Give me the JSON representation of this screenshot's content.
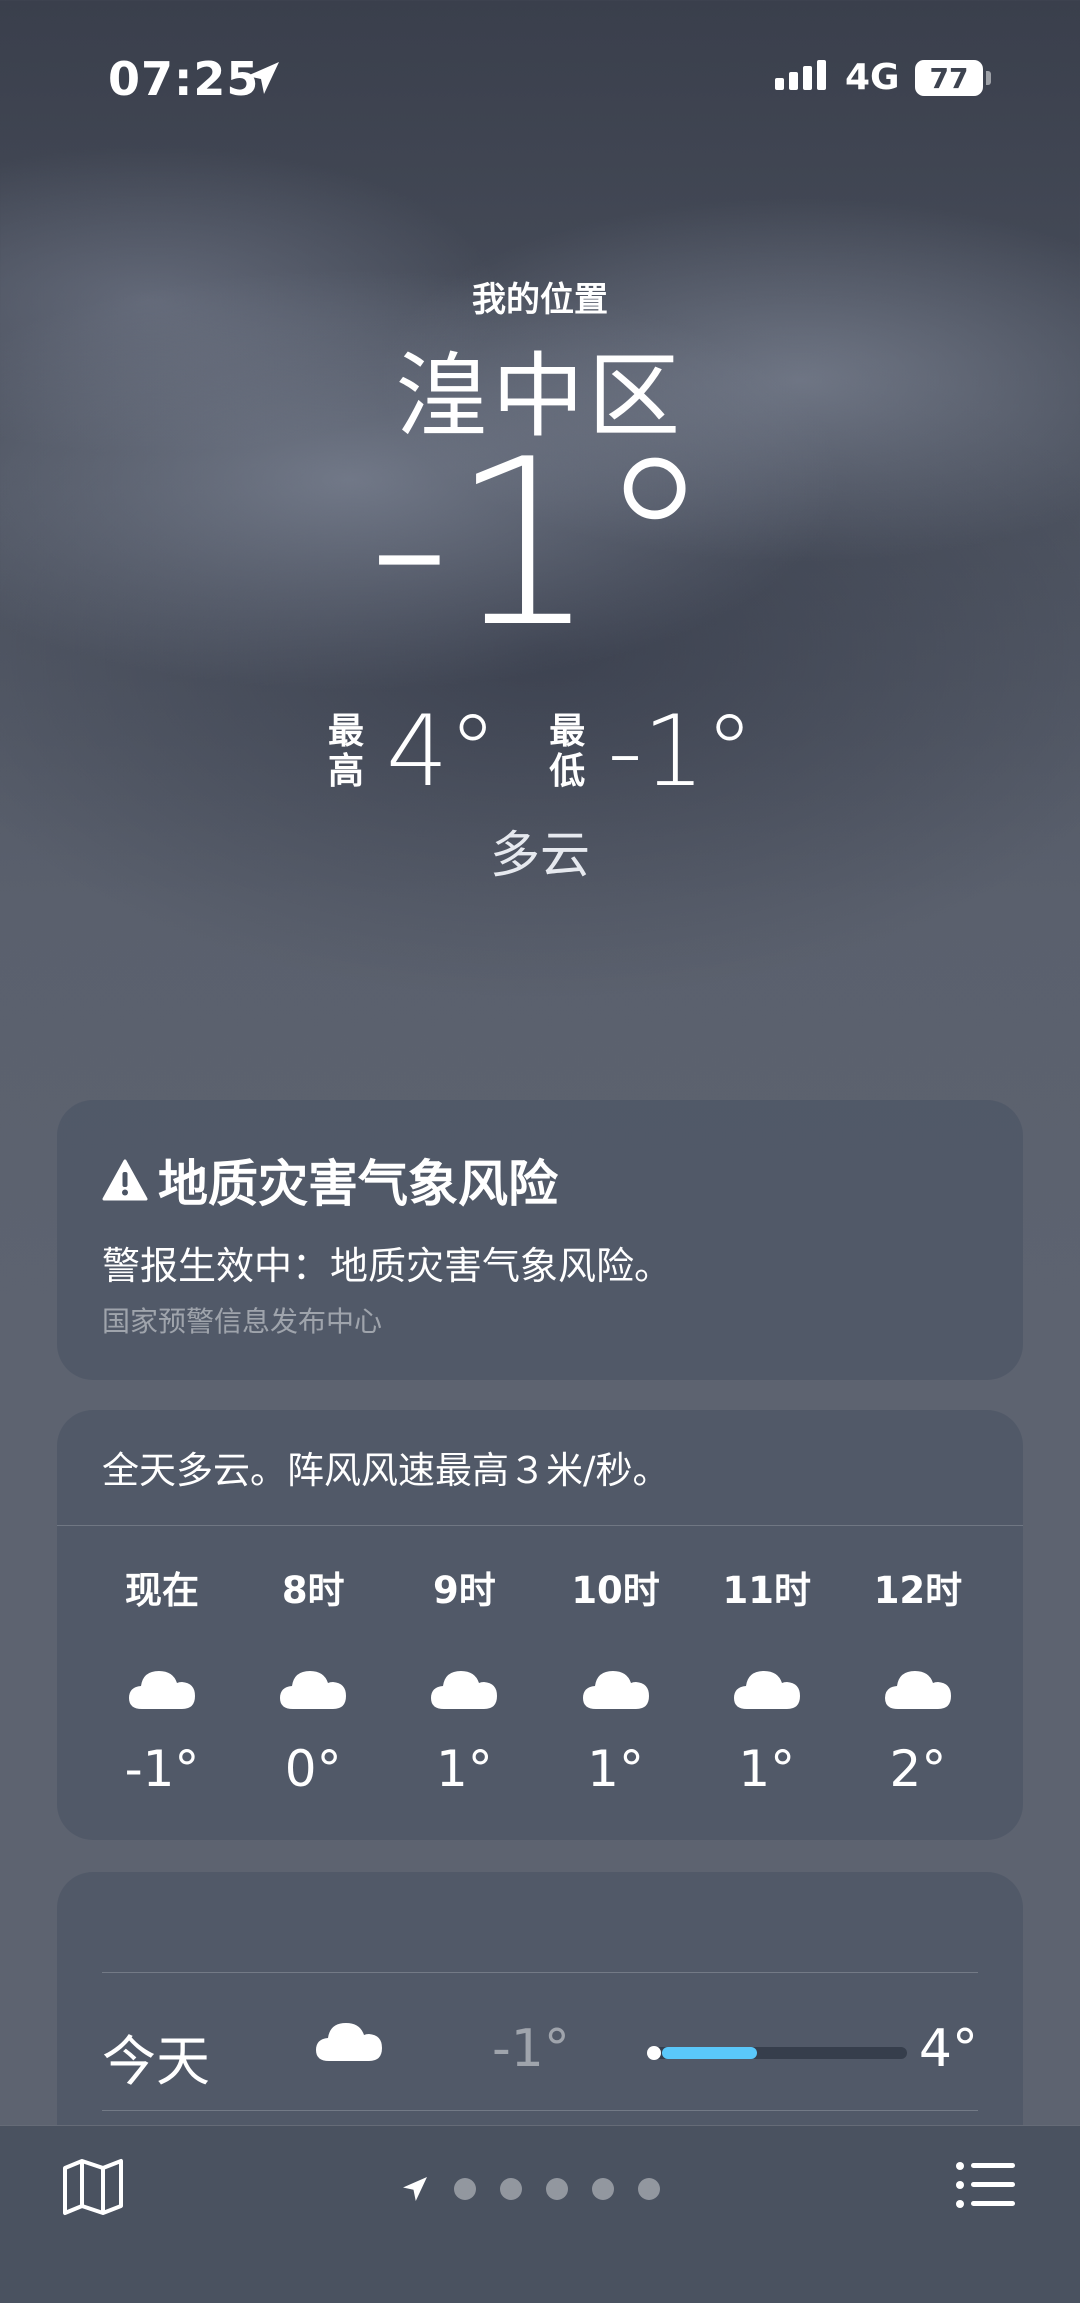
{
  "status_bar": {
    "time": "07:25",
    "network": "4G",
    "battery": "77"
  },
  "header": {
    "location_label": "我的位置",
    "city": "湟中区",
    "temperature": "-1°",
    "high_label": "最高",
    "high": "4°",
    "low_label": "最低",
    "low": "-1°",
    "condition": "多云"
  },
  "alert": {
    "title": "地质灾害气象风险",
    "body": "警报生效中：地质灾害气象风险。",
    "source": "国家预警信息发布中心"
  },
  "hourly": {
    "summary": "全天多云。阵风风速最高３米/秒。",
    "hours": [
      {
        "label": "现在",
        "icon": "cloud-icon",
        "temp": "-1°"
      },
      {
        "label": "8时",
        "icon": "cloud-icon",
        "temp": "0°"
      },
      {
        "label": "9时",
        "icon": "cloud-icon",
        "temp": "1°"
      },
      {
        "label": "10时",
        "icon": "cloud-icon",
        "temp": "1°"
      },
      {
        "label": "11时",
        "icon": "cloud-icon",
        "temp": "1°"
      },
      {
        "label": "12时",
        "icon": "cloud-icon",
        "temp": "2°"
      }
    ]
  },
  "daily": {
    "rows": [
      {
        "day": "今天",
        "icon": "cloud-icon",
        "low": "-1°",
        "high": "4°",
        "range_start": 0.0,
        "range_end": 0.35
      }
    ]
  },
  "bottom_bar": {
    "page_count": 5,
    "accent": "#5ac8fa"
  }
}
